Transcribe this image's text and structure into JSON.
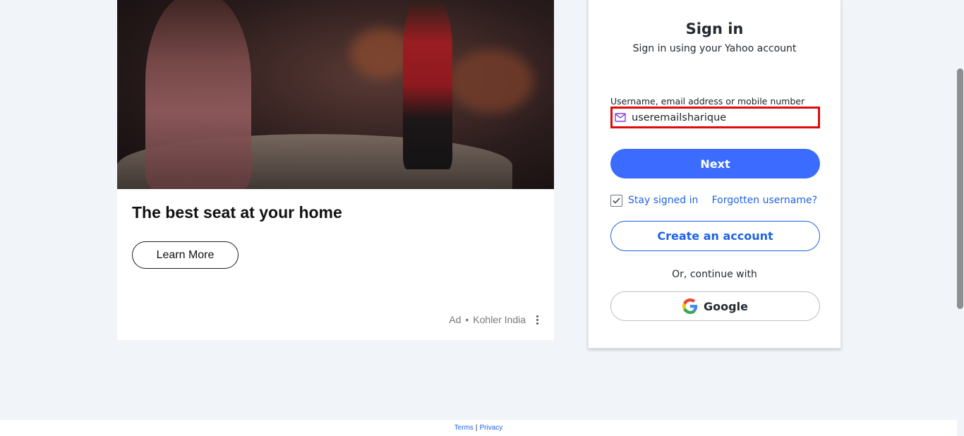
{
  "ad": {
    "headline": "The best seat at your home",
    "cta_label": "Learn More",
    "ad_label": "Ad",
    "separator": "•",
    "advertiser": "Kohler India"
  },
  "signin": {
    "title": "Sign in",
    "subtitle": "Sign in using your Yahoo account",
    "username_label": "Username, email address or mobile number",
    "username_value": "useremailsharique",
    "next_label": "Next",
    "stay_signed_in_label": "Stay signed in",
    "stay_signed_in_checked": true,
    "forgot_label": "Forgotten username?",
    "create_account_label": "Create an account",
    "or_continue_label": "Or, continue with",
    "google_label": "Google"
  },
  "footer": {
    "terms_label": "Terms",
    "separator": "|",
    "privacy_label": "Privacy"
  },
  "colors": {
    "accent": "#3b6cff",
    "link": "#1f63e6",
    "input_highlight": "#e00b0b",
    "background": "#f1f5f9"
  },
  "icons": [
    "mail-icon",
    "check-icon",
    "kebab-icon",
    "google-icon"
  ]
}
